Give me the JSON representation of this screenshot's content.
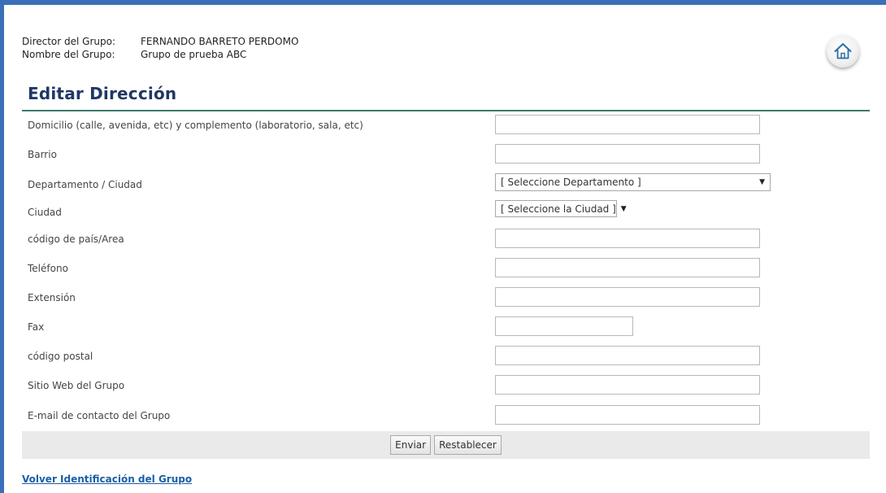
{
  "header": {
    "director_label": "Director del Grupo:",
    "director_value": "FERNANDO BARRETO PERDOMO",
    "group_label": "Nombre del Grupo:",
    "group_value": "Grupo de prueba ABC",
    "home_icon": "home-icon"
  },
  "form": {
    "title": "Editar Dirección",
    "fields": {
      "domicilio": {
        "label": "Domicilio (calle, avenida, etc) y complemento (laboratorio, sala, etc)",
        "value": ""
      },
      "barrio": {
        "label": "Barrio",
        "value": ""
      },
      "departamento": {
        "label": "Departamento / Ciudad",
        "selected": "[ Seleccione Departamento ]"
      },
      "ciudad": {
        "label": "Ciudad",
        "selected": "[ Seleccione la Ciudad ]"
      },
      "codigo_pais": {
        "label": "código de país/Area",
        "value": ""
      },
      "telefono": {
        "label": "Teléfono",
        "value": ""
      },
      "extension": {
        "label": "Extensión",
        "value": ""
      },
      "fax": {
        "label": "Fax",
        "value": ""
      },
      "codigo_postal": {
        "label": "código postal",
        "value": ""
      },
      "sitio_web": {
        "label": "Sitio Web del Grupo",
        "value": ""
      },
      "email": {
        "label": "E-mail de contacto del Grupo",
        "value": ""
      }
    },
    "buttons": {
      "submit": "Enviar",
      "reset": "Restablecer"
    }
  },
  "footer": {
    "back_link": "Volver Identificación del Grupo"
  },
  "colors": {
    "frame": "#3a70b8",
    "title": "#1f3864",
    "title_rule": "#3d7a6d",
    "link": "#1a5fa6",
    "button_bar": "#eaeaea"
  }
}
